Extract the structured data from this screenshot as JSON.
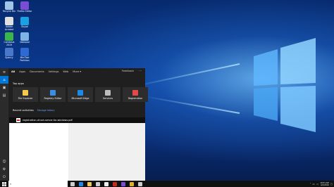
{
  "desktop": {
    "icons": [
      {
        "label": "Recycle Bin",
        "name": "recycle-bin-icon",
        "color": "#9fc6e8"
      },
      {
        "label": "Firefox Editor",
        "name": "firefox-icon",
        "color": "#7b4dd6"
      },
      {
        "label": "Adobe Acrobat",
        "name": "acrobat-icon",
        "color": "#e0e0e0"
      },
      {
        "label": "Skype",
        "name": "skype-icon",
        "color": "#1aa1e2"
      },
      {
        "label": "Camtasia 2019",
        "name": "camtasia-icon",
        "color": "#3bb54a"
      },
      {
        "label": "Notepad",
        "name": "notepad-icon",
        "color": "#7fb4e6"
      },
      {
        "label": "Speccy",
        "name": "speccy-icon",
        "color": "#4a78c8"
      },
      {
        "label": "MiniTool Partition",
        "name": "partition-icon",
        "color": "#2d6bd3"
      }
    ]
  },
  "start_panel": {
    "tabs": [
      {
        "label": "All",
        "active": true
      },
      {
        "label": "Apps",
        "active": false
      },
      {
        "label": "Documents",
        "active": false
      },
      {
        "label": "Settings",
        "active": false
      },
      {
        "label": "Web",
        "active": false
      },
      {
        "label": "More ▾",
        "active": false
      }
    ],
    "feedback_label": "Feedback",
    "top_apps_title": "Top apps",
    "top_apps": [
      {
        "label": "File Explorer",
        "name": "file-explorer-icon",
        "color": "#f2c94c"
      },
      {
        "label": "Registry Editor",
        "name": "registry-editor-icon",
        "color": "#3a8ee6"
      },
      {
        "label": "Microsoft Edge",
        "name": "edge-icon",
        "color": "#1e88e5"
      },
      {
        "label": "Services",
        "name": "services-icon",
        "color": "#bdbdbd"
      },
      {
        "label": "Registration",
        "name": "registration-icon",
        "color": "#e24a4a"
      }
    ],
    "recent_title": "Recent activities",
    "recent_link": "Manage history",
    "recent_item": "registration-of-ssh-server-for-windows.pdf"
  },
  "taskbar": {
    "search_value": "",
    "clock_time": "10:51 AM",
    "clock_date": "4/1/2019",
    "pinned": [
      {
        "name": "task-view-icon",
        "color": "#cccccc"
      },
      {
        "name": "edge-taskbar-icon",
        "color": "#1e88e5"
      },
      {
        "name": "explorer-taskbar-icon",
        "color": "#f2c94c"
      },
      {
        "name": "store-taskbar-icon",
        "color": "#cccccc"
      },
      {
        "name": "camera-taskbar-icon",
        "color": "#eeeeee"
      },
      {
        "name": "acrobat-taskbar-icon",
        "color": "#c42b1c"
      },
      {
        "name": "firefox-taskbar-icon",
        "color": "#7b4dd6"
      },
      {
        "name": "chrome-taskbar-icon",
        "color": "#e0b02c"
      },
      {
        "name": "media-taskbar-icon",
        "color": "#cccccc"
      }
    ]
  }
}
